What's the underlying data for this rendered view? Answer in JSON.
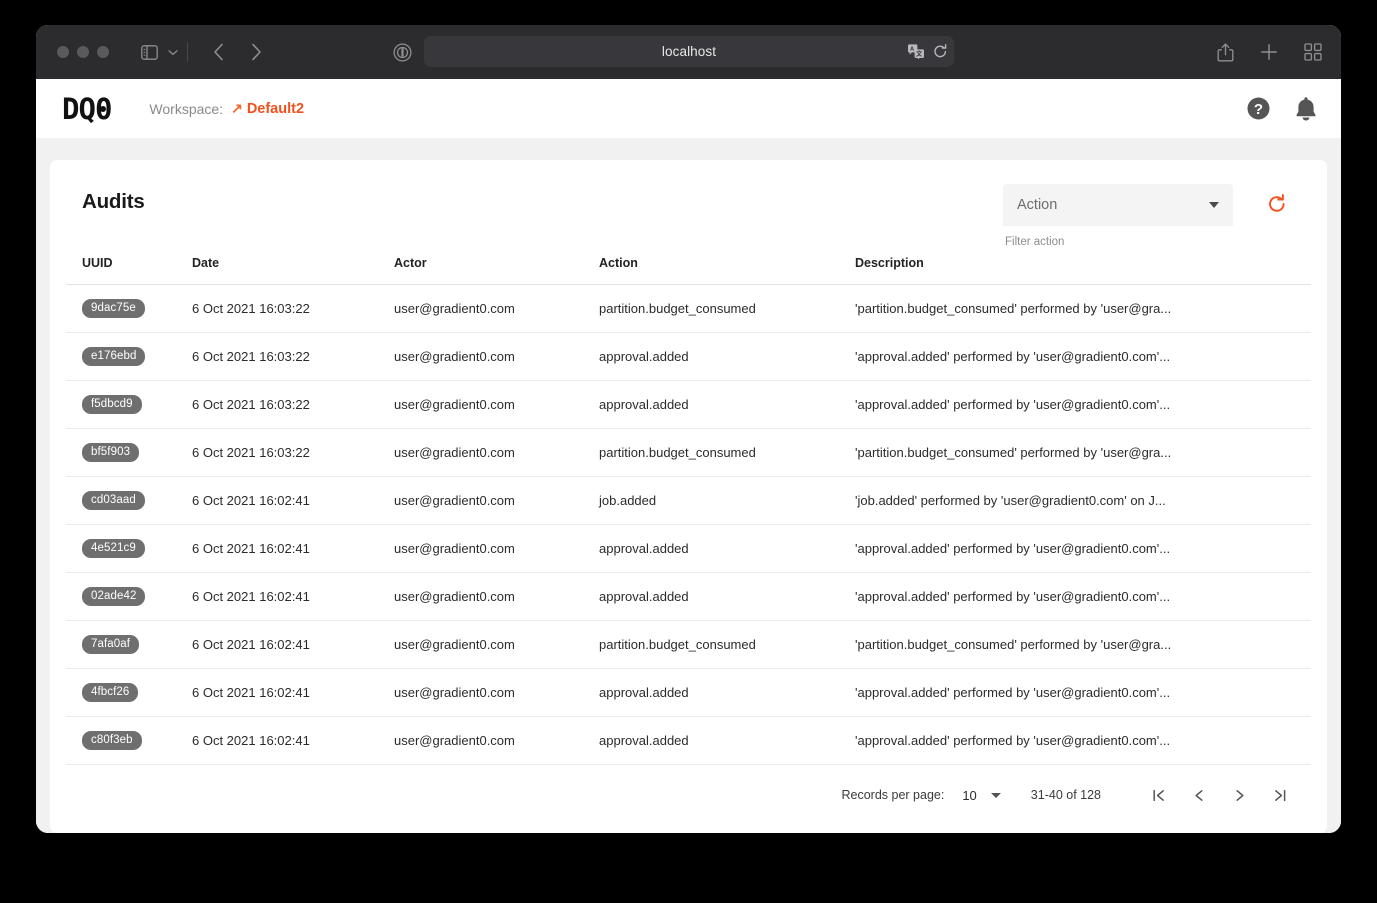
{
  "browser": {
    "url": "localhost",
    "icons": {
      "traffic_close": "close-dot",
      "traffic_minimize": "minimize-dot",
      "traffic_maximize": "maximize-dot",
      "sidebar": "sidebar-toggle-icon",
      "chevron_down": "chevron-down-icon",
      "back": "back-arrow-icon",
      "forward": "forward-arrow-icon",
      "reader": "reader-mode-icon",
      "privacy": "privacy-shield-icon",
      "translate": "translate-icon",
      "reload": "reload-icon",
      "share": "share-icon",
      "new_tab": "plus-icon",
      "tab_overview": "tab-overview-icon"
    }
  },
  "app_header": {
    "logo_d": "D",
    "logo_q": "Q",
    "logo_zero": "0",
    "workspace_label": "Workspace:",
    "workspace_arrow": "↗",
    "workspace_name": "Default2",
    "help_icon": "help-circle-icon",
    "bell_icon": "notification-bell-icon"
  },
  "audits": {
    "title": "Audits",
    "filter": {
      "selected": "Action",
      "helper_text": "Filter action",
      "caret_icon": "chevron-down-icon"
    },
    "refresh_icon": "refresh-icon",
    "columns": [
      "UUID",
      "Date",
      "Actor",
      "Action",
      "Description"
    ],
    "rows": [
      {
        "uuid": "9dac75e",
        "date": "6 Oct 2021 16:03:22",
        "actor": "user@gradient0.com",
        "action": "partition.budget_consumed",
        "description": "'partition.budget_consumed' performed by 'user@gra..."
      },
      {
        "uuid": "e176ebd",
        "date": "6 Oct 2021 16:03:22",
        "actor": "user@gradient0.com",
        "action": "approval.added",
        "description": "'approval.added' performed by 'user@gradient0.com'..."
      },
      {
        "uuid": "f5dbcd9",
        "date": "6 Oct 2021 16:03:22",
        "actor": "user@gradient0.com",
        "action": "approval.added",
        "description": "'approval.added' performed by 'user@gradient0.com'..."
      },
      {
        "uuid": "bf5f903",
        "date": "6 Oct 2021 16:03:22",
        "actor": "user@gradient0.com",
        "action": "partition.budget_consumed",
        "description": "'partition.budget_consumed' performed by 'user@gra..."
      },
      {
        "uuid": "cd03aad",
        "date": "6 Oct 2021 16:02:41",
        "actor": "user@gradient0.com",
        "action": "job.added",
        "description": "'job.added' performed by 'user@gradient0.com' on J..."
      },
      {
        "uuid": "4e521c9",
        "date": "6 Oct 2021 16:02:41",
        "actor": "user@gradient0.com",
        "action": "approval.added",
        "description": "'approval.added' performed by 'user@gradient0.com'..."
      },
      {
        "uuid": "02ade42",
        "date": "6 Oct 2021 16:02:41",
        "actor": "user@gradient0.com",
        "action": "approval.added",
        "description": "'approval.added' performed by 'user@gradient0.com'..."
      },
      {
        "uuid": "7afa0af",
        "date": "6 Oct 2021 16:02:41",
        "actor": "user@gradient0.com",
        "action": "partition.budget_consumed",
        "description": "'partition.budget_consumed' performed by 'user@gra..."
      },
      {
        "uuid": "4fbcf26",
        "date": "6 Oct 2021 16:02:41",
        "actor": "user@gradient0.com",
        "action": "approval.added",
        "description": "'approval.added' performed by 'user@gradient0.com'..."
      },
      {
        "uuid": "c80f3eb",
        "date": "6 Oct 2021 16:02:41",
        "actor": "user@gradient0.com",
        "action": "approval.added",
        "description": "'approval.added' performed by 'user@gradient0.com'..."
      }
    ],
    "pagination": {
      "records_label": "Records per page:",
      "records_value": "10",
      "range": "31-40 of 128",
      "first_icon": "first-page-icon",
      "prev_icon": "previous-page-icon",
      "next_icon": "next-page-icon",
      "last_icon": "last-page-icon"
    }
  },
  "colors": {
    "accent_orange": "#f4501e",
    "refresh_orange": "#f4501e",
    "badge_gray": "#6f6f6f",
    "page_bg": "#f1f1f1",
    "toolbar_bg": "#2c2c2e"
  }
}
